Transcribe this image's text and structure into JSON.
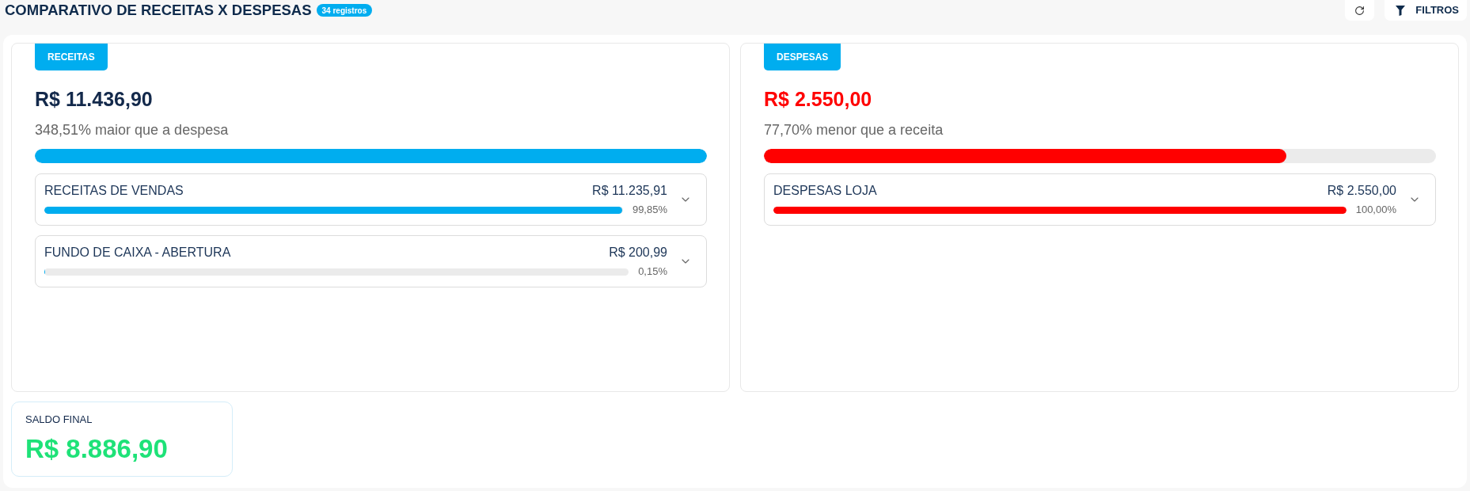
{
  "header": {
    "title": "COMPARATIVO DE RECEITAS X DESPESAS",
    "badge": "34 registros"
  },
  "toolbar": {
    "buttons": [
      {
        "kind": "refresh"
      },
      {
        "kind": "filter",
        "label": "FILTROS"
      }
    ]
  },
  "panels": [
    {
      "kind": "income",
      "tag": "RECEITAS",
      "total": "R$ 11.436,90",
      "comparison": "348,51% maior que a despesa",
      "level": 1,
      "categories": [
        {
          "name": "RECEITAS DE VENDAS",
          "amount": "R$ 11.235,91",
          "share": "99,85%",
          "level": 0.9985,
          "expanded": false
        },
        {
          "name": "FUNDO DE CAIXA - ABERTURA",
          "amount": "R$ 200,99",
          "share": "0,15%",
          "level": 0.0015,
          "expanded": false
        }
      ]
    },
    {
      "kind": "expense",
      "tag": "DESPESAS",
      "total": "R$ 2.550,00",
      "comparison": "77,70% menor que a receita",
      "level": 0.777,
      "categories": [
        {
          "name": "DESPESAS LOJA",
          "amount": "R$ 2.550,00",
          "share": "100,00%",
          "level": 1,
          "expanded": false
        }
      ]
    }
  ],
  "summary": {
    "label": "SALDO FINAL",
    "value": "R$ 8.886,90"
  }
}
